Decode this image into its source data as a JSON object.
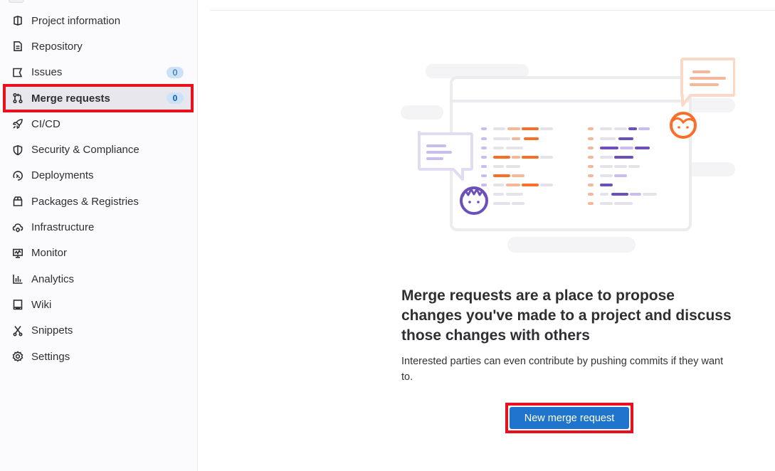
{
  "sidebar": {
    "items": [
      {
        "key": "project-information",
        "label": "Project information",
        "icon": "project-icon"
      },
      {
        "key": "repository",
        "label": "Repository",
        "icon": "doc-icon"
      },
      {
        "key": "issues",
        "label": "Issues",
        "icon": "issues-icon",
        "badge": "0"
      },
      {
        "key": "merge-requests",
        "label": "Merge requests",
        "icon": "merge-request-icon",
        "badge": "0",
        "active": true
      },
      {
        "key": "ci-cd",
        "label": "CI/CD",
        "icon": "rocket-icon"
      },
      {
        "key": "security-compliance",
        "label": "Security & Compliance",
        "icon": "shield-icon"
      },
      {
        "key": "deployments",
        "label": "Deployments",
        "icon": "deployments-icon"
      },
      {
        "key": "packages-registries",
        "label": "Packages & Registries",
        "icon": "package-icon"
      },
      {
        "key": "infrastructure",
        "label": "Infrastructure",
        "icon": "cloud-gear-icon"
      },
      {
        "key": "monitor",
        "label": "Monitor",
        "icon": "monitor-icon"
      },
      {
        "key": "analytics",
        "label": "Analytics",
        "icon": "chart-icon"
      },
      {
        "key": "wiki",
        "label": "Wiki",
        "icon": "book-icon"
      },
      {
        "key": "snippets",
        "label": "Snippets",
        "icon": "scissors-icon"
      },
      {
        "key": "settings",
        "label": "Settings",
        "icon": "gear-icon"
      }
    ]
  },
  "empty_state": {
    "title": "Merge requests are a place to propose changes you've made to a project and discuss those changes with others",
    "description": "Interested parties can even contribute by pushing commits if they want to.",
    "button_label": "New merge request"
  },
  "colors": {
    "accent": "#1f75cb",
    "highlight": "#e8101c",
    "badge_bg": "#cbe2f9",
    "illustration_orange": "#fc6d26",
    "illustration_purple": "#6b4fbb"
  }
}
